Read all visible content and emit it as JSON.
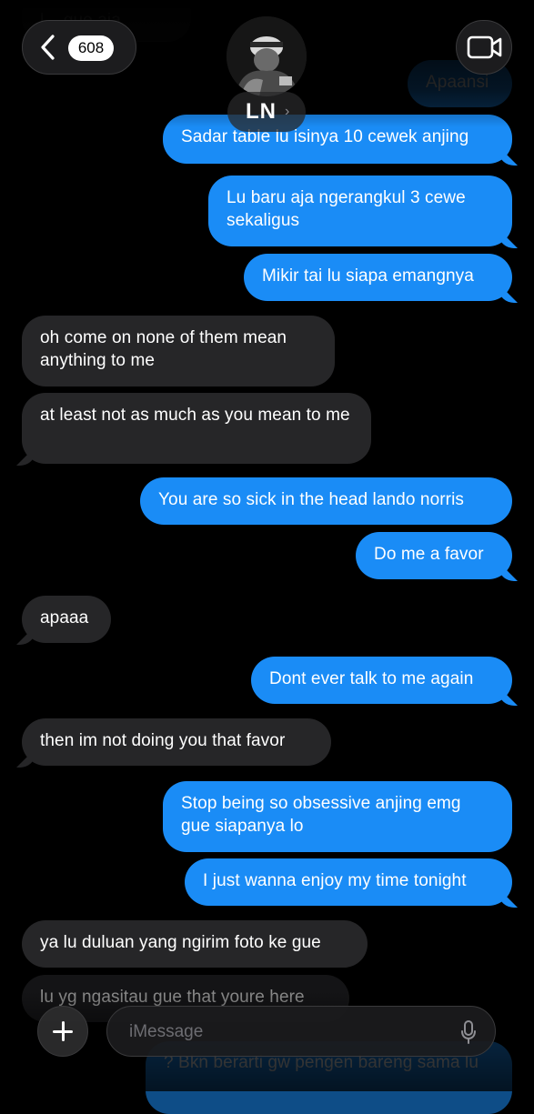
{
  "header": {
    "unread_count": "608",
    "contact_initials": "LN",
    "contact_chevron": "›"
  },
  "messages": [
    {
      "side": "in",
      "text": "l... gue aja"
    },
    {
      "side": "out",
      "text": "Apaansi"
    },
    {
      "side": "out",
      "text": "Sadar table lu isinya 10 cewek anjing"
    },
    {
      "side": "out",
      "text": "Lu baru aja ngerangkul 3 cewe sekaligus"
    },
    {
      "side": "out",
      "text": "Mikir tai lu siapa emangnya"
    },
    {
      "side": "in",
      "text": "oh come on none of them mean anything to me"
    },
    {
      "side": "in",
      "text": "at least not as much as you mean to me"
    },
    {
      "side": "out",
      "text": "You are so sick in the head lando norris"
    },
    {
      "side": "out",
      "text": "Do me a favor"
    },
    {
      "side": "in",
      "text": "apaaa"
    },
    {
      "side": "out",
      "text": "Dont ever talk to me again"
    },
    {
      "side": "in",
      "text": "then im not doing you that favor"
    },
    {
      "side": "out",
      "text": "Stop being so obsessive anjing emg gue siapanya lo"
    },
    {
      "side": "out",
      "text": "I just wanna enjoy my time tonight"
    },
    {
      "side": "in",
      "text": "ya lu duluan yang ngirim foto ke gue"
    },
    {
      "side": "in",
      "text": "lu yg ngasitau gue that youre here"
    },
    {
      "side": "out",
      "text": "? Bkn berarti gw pengen bareng sama lu"
    }
  ],
  "composer": {
    "placeholder": "iMessage"
  },
  "icons": {
    "back": "chevron-left-icon",
    "video": "video-camera-icon",
    "add": "plus-icon",
    "mic": "microphone-icon"
  },
  "colors": {
    "outgoing_bubble": "#1a8cf6",
    "incoming_bubble": "#262628",
    "background": "#000000"
  }
}
